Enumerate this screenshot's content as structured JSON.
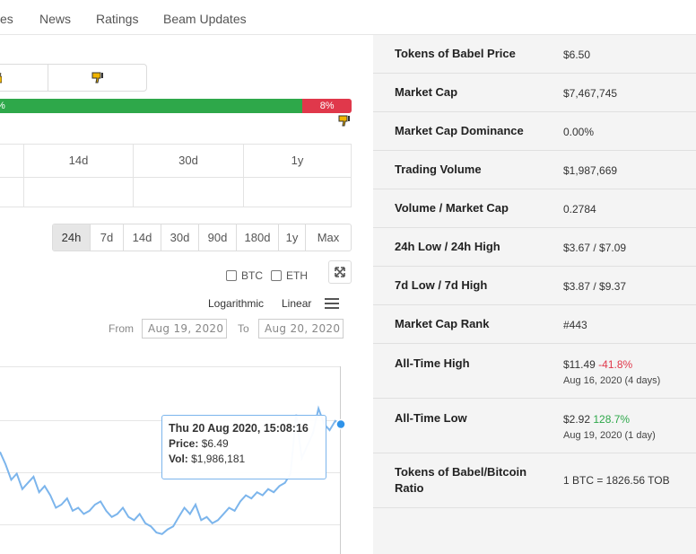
{
  "nav": {
    "tabs": [
      "es",
      "News",
      "Ratings",
      "Beam Updates"
    ]
  },
  "sentiment": {
    "good_label": "%",
    "good_pct": 92,
    "bad_label": "8%",
    "bad_pct": 8
  },
  "performance": {
    "headers": [
      "14d",
      "30d",
      "1y"
    ]
  },
  "ranges": [
    "24h",
    "7d",
    "14d",
    "30d",
    "90d",
    "180d",
    "1y",
    "Max"
  ],
  "active_range": "24h",
  "compare": {
    "btc": "BTC",
    "eth": "ETH"
  },
  "scale": {
    "log": "Logarithmic",
    "linear": "Linear"
  },
  "dates": {
    "from_label": "From",
    "from": "Aug 19, 2020",
    "to_label": "To",
    "to": "Aug 20, 2020"
  },
  "tooltip": {
    "title": "Thu 20 Aug 2020, 15:08:16",
    "price_label": "Price:",
    "price": "$6.49",
    "vol_label": "Vol:",
    "vol": "$1,986,181"
  },
  "colors": {
    "green": "#2ea84a",
    "red": "#e0384b",
    "line": "#7cb5ec"
  },
  "chart_data": {
    "type": "line",
    "series": [
      {
        "values": [
          5.6,
          5.2,
          4.7,
          4.9,
          4.4,
          4.6,
          4.8,
          4.3,
          4.5,
          4.2,
          3.8,
          3.9,
          4.1,
          3.7,
          3.8,
          3.6,
          3.7,
          3.9,
          4.0,
          3.7,
          3.5,
          3.6,
          3.8,
          3.5,
          3.4,
          3.6,
          3.3,
          3.2,
          3.0,
          2.95,
          3.1,
          3.2,
          3.5,
          3.8,
          3.6,
          3.9,
          3.4,
          3.5,
          3.3,
          3.4,
          3.6,
          3.8,
          3.7,
          4.0,
          4.2,
          4.1,
          4.3,
          4.2,
          4.4,
          4.3,
          4.5,
          4.6,
          4.9,
          6.8,
          5.4,
          5.8,
          6.2,
          7.0,
          6.5,
          6.3,
          6.6,
          6.49
        ]
      }
    ]
  },
  "stats": [
    {
      "label": "Tokens of Babel Price",
      "value": "$6.50"
    },
    {
      "label": "Market Cap",
      "value": "$7,467,745"
    },
    {
      "label": "Market Cap Dominance",
      "value": "0.00%"
    },
    {
      "label": "Trading Volume",
      "value": "$1,987,669"
    },
    {
      "label": "Volume / Market Cap",
      "value": "0.2784"
    },
    {
      "label": "24h Low / 24h High",
      "value": "$3.67 / $7.09"
    },
    {
      "label": "7d Low / 7d High",
      "value": "$3.87 / $9.37"
    },
    {
      "label": "Market Cap Rank",
      "value": "#443"
    },
    {
      "label": "All-Time High",
      "value": "$11.49",
      "change": "-41.8%",
      "sub": "Aug 16, 2020 (4 days)"
    },
    {
      "label": "All-Time Low",
      "value": "$2.92",
      "change": "128.7%",
      "sub": "Aug 19, 2020 (1 day)"
    },
    {
      "label": "Tokens of Babel/Bitcoin Ratio",
      "value": "1 BTC = 1826.56 TOB"
    }
  ]
}
